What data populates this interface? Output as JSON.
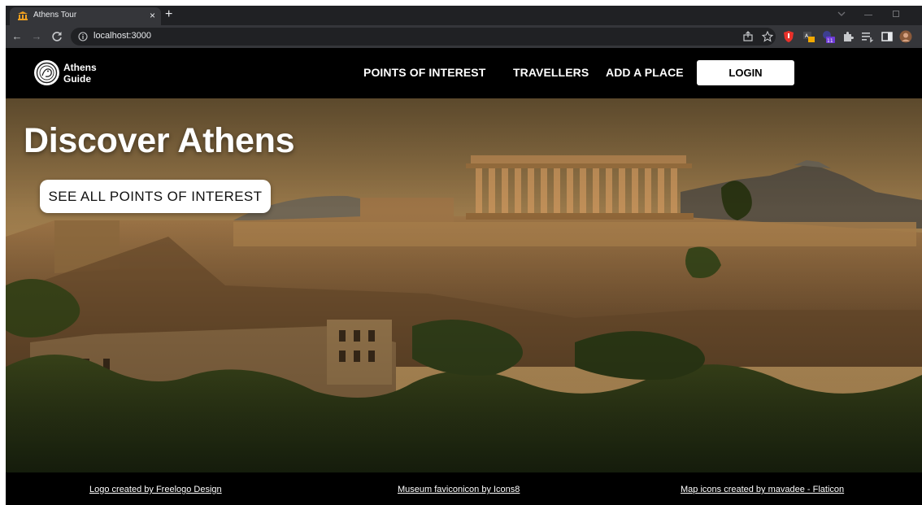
{
  "browser": {
    "tab": {
      "title": "Athens Tour",
      "close": "×",
      "favicon": "museum-icon"
    },
    "new_tab": "+",
    "address_bar": {
      "url": "localhost:3000"
    },
    "nav_buttons": {
      "back": "←",
      "forward": "→",
      "reload": "C"
    },
    "extensions": {
      "mail_badge": "11"
    }
  },
  "site": {
    "logo": {
      "line1": "Athens",
      "line2": "Guide"
    },
    "nav": [
      "POINTS OF INTEREST",
      "TRAVELLERS",
      "ADD A PLACE"
    ],
    "login": "LOGIN"
  },
  "hero": {
    "title": "Discover Athens",
    "cta": "SEE ALL POINTS OF INTEREST"
  },
  "footer": {
    "credits": [
      "Logo created by Freelogo Design",
      "Museum faviconicon by Icons8",
      "Map icons created by mavadee - Flaticon"
    ]
  },
  "colors": {
    "chrome_dark": "#202124",
    "chrome_toolbar": "#35363a",
    "nav_bg": "#000000",
    "text_light": "#ffffff",
    "cta_bg": "#ffffff"
  }
}
